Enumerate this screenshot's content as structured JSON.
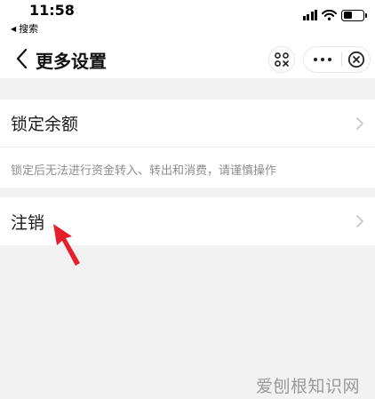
{
  "status_bar": {
    "time": "11:58",
    "back_app_label": "搜索",
    "back_app_icon": "triangle-left-icon",
    "icons": [
      "signal-icon",
      "wifi-icon",
      "battery-icon"
    ]
  },
  "nav": {
    "title": "更多设置",
    "back_icon": "chevron-left-icon",
    "scan_icon": "scan-icon",
    "more_icon": "more-dots-icon",
    "close_icon": "close-circle-icon"
  },
  "rows": [
    {
      "label": "锁定余额",
      "icon": "chevron-right-icon"
    },
    {
      "label": "注销",
      "icon": "chevron-right-icon"
    }
  ],
  "note": "锁定后无法进行资金转入、转出和消费，请谨慎操作",
  "annotation": {
    "icon": "red-arrow-icon",
    "color": "#e5202a"
  },
  "watermark": "爱刨根知识网"
}
